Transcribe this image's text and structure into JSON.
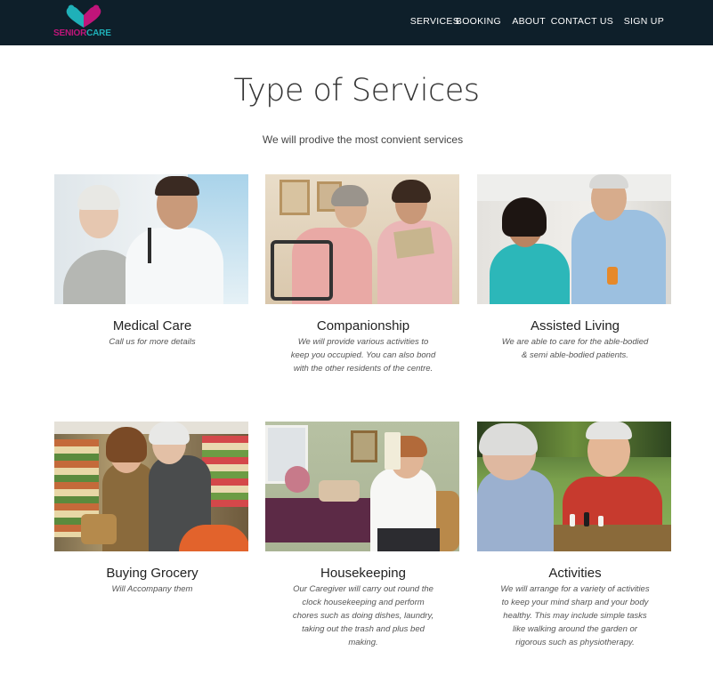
{
  "brand": {
    "logo_part1": "SENIOR",
    "logo_part2": "CARE",
    "color_pink": "#c0157a",
    "color_teal": "#1fb0b8"
  },
  "nav": {
    "items": [
      "SERVICES",
      "BOOKING",
      "ABOUT",
      "CONTACT US",
      "SIGN UP"
    ]
  },
  "page": {
    "title": "Type of Services",
    "subtitle": "We will prodive the most convient services"
  },
  "services": [
    {
      "title": "Medical Care",
      "description": "Call us for more details"
    },
    {
      "title": "Companionship",
      "description": "We will provide various activities to keep you occupied. You can also bond with the other residents of the centre."
    },
    {
      "title": "Assisted Living",
      "description": "We are able to care for the able-bodied & semi able-bodied patients."
    },
    {
      "title": "Buying Grocery",
      "description": "Will Accompany them"
    },
    {
      "title": "Housekeeping",
      "description": "Our Caregiver will carry out round the clock housekeeping and perform chores such as doing dishes, laundry, taking out the trash and plus bed making."
    },
    {
      "title": "Activities",
      "description": "We will arrange for a variety of activities to keep your mind sharp and your body healthy. This may include simple tasks like walking around the garden or rigorous such as physiotherapy."
    }
  ],
  "colors": {
    "navbar_bg": "#0e1f2a"
  }
}
